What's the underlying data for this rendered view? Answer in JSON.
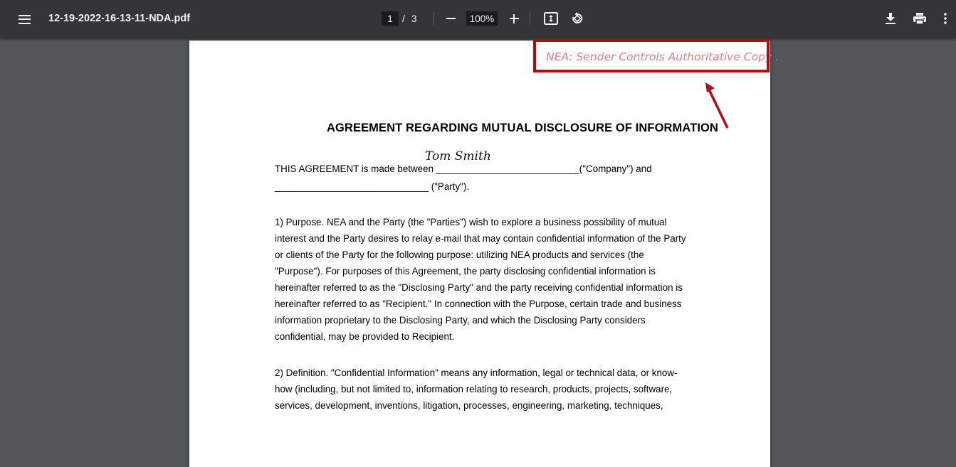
{
  "toolbar": {
    "filename": "12-19-2022-16-13-11-NDA.pdf",
    "current_page": "1",
    "page_separator": "/",
    "total_pages": "3",
    "zoom": "100%"
  },
  "document": {
    "header_note": "NEA: Sender Controls Authoritative Copy .",
    "title": "AGREEMENT REGARDING MUTUAL DISCLOSURE OF INFORMATION",
    "signature": "Tom Smith",
    "intro_lines": [
      "THIS AGREEMENT is made between ___________________________(\"Company\") and",
      "_____________________________ (\"Party\")."
    ],
    "purpose_lines": [
      "1) Purpose.  NEA and the Party (the \"Parties\") wish to explore a business possibility of mutual",
      "interest and the Party desires to relay e-mail that may contain confidential information of the Party",
      "or clients of the Party for the following purpose: utilizing NEA products and services (the",
      "\"Purpose\").  For purposes of this Agreement, the party disclosing confidential information is",
      "hereinafter referred to as the \"Disclosing Party\" and the party receiving confidential information is",
      "hereinafter referred to as \"Recipient.\"  In connection with the Purpose, certain trade and business",
      "information proprietary to the Disclosing Party, and which the Disclosing Party considers",
      "confidential, may be provided to Recipient."
    ],
    "definition_lines": [
      "2) Definition.  \"Confidential Information\" means any information, legal or technical data, or know-",
      "how (including, but not limited to, information relating to research, products, projects, software,",
      "services, development, inventions, litigation, processes, engineering, marketing, techniques,"
    ]
  },
  "colors": {
    "toolbar_bg": "#323639",
    "viewer_bg": "#525659",
    "highlight": "#b10a14",
    "header_note": "#e97b82"
  },
  "icons": [
    "menu-icon",
    "zoom-out-icon",
    "zoom-in-icon",
    "fit-to-page-icon",
    "rotate-icon",
    "download-icon",
    "print-icon",
    "more-vert-icon"
  ]
}
